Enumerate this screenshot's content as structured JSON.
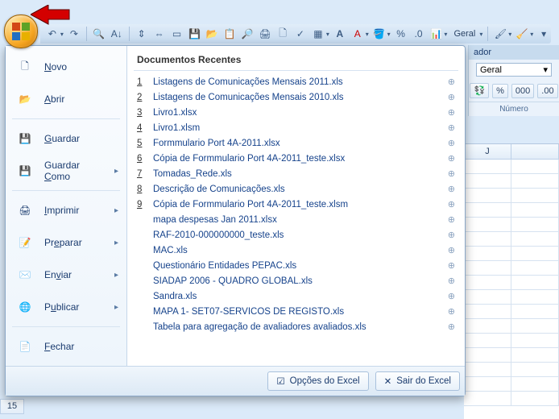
{
  "qat": {
    "number_format": "Geral"
  },
  "ribbon": {
    "tab_extra": "ador",
    "format_value": "Geral",
    "percent": "%",
    "thousand": "000",
    "group_label": "Número"
  },
  "menu": {
    "items": {
      "new": "Novo",
      "open": "Abrir",
      "save": "Guardar",
      "save_as": "Guardar Como",
      "print": "Imprimir",
      "prepare": "Preparar",
      "send": "Enviar",
      "publish": "Publicar",
      "close": "Fechar"
    },
    "recent_title": "Documentos Recentes",
    "recent": [
      {
        "n": "1",
        "name": "Listagens de Comunicações Mensais 2011.xls"
      },
      {
        "n": "2",
        "name": "Listagens de Comunicações Mensais 2010.xls"
      },
      {
        "n": "3",
        "name": "Livro1.xlsx"
      },
      {
        "n": "4",
        "name": "Livro1.xlsm"
      },
      {
        "n": "5",
        "name": "Formmulario Port 4A-2011.xlsx"
      },
      {
        "n": "6",
        "name": "Cópia de Formmulario Port 4A-2011_teste.xlsx"
      },
      {
        "n": "7",
        "name": "Tomadas_Rede.xls"
      },
      {
        "n": "8",
        "name": "Descrição de Comunicações.xls"
      },
      {
        "n": "9",
        "name": "Cópia de Formmulario Port 4A-2011_teste.xlsm"
      },
      {
        "n": "",
        "name": "mapa despesas Jan 2011.xlsx"
      },
      {
        "n": "",
        "name": "RAF-2010-000000000_teste.xls"
      },
      {
        "n": "",
        "name": "MAC.xls"
      },
      {
        "n": "",
        "name": "Questionário Entidades PEPAC.xls"
      },
      {
        "n": "",
        "name": "SIADAP 2006 - QUADRO GLOBAL.xls"
      },
      {
        "n": "",
        "name": "Sandra.xls"
      },
      {
        "n": "",
        "name": "MAPA 1- SET07-SERVICOS DE REGISTO.xls"
      },
      {
        "n": "",
        "name": "Tabela para agregação de avaliadores avaliados.xls"
      }
    ],
    "footer": {
      "options": "Opções do Excel",
      "exit": "Sair do Excel"
    }
  },
  "grid": {
    "col_j": "J",
    "row_15": "15"
  }
}
